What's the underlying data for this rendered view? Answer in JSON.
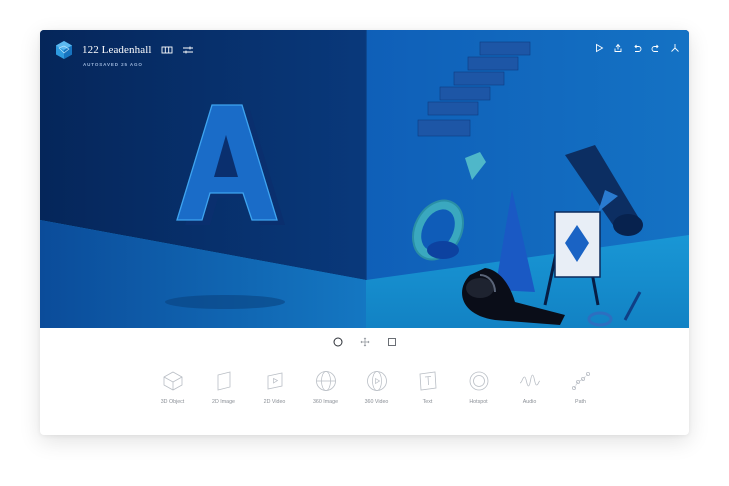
{
  "project": {
    "title": "122 Leadenhall",
    "autosave_status": "AUTOSAVED 25 AGO"
  },
  "header_icons_left": [
    "map-icon",
    "settings-sliders-icon"
  ],
  "header_icons_right": [
    "play-icon",
    "share-icon",
    "undo-icon",
    "redo-icon",
    "compass-icon"
  ],
  "view_modes": [
    "sphere-view-icon",
    "move-icon",
    "square-view-icon"
  ],
  "toolbar": {
    "items": [
      {
        "label": "3D Object",
        "icon": "cube-icon"
      },
      {
        "label": "2D Image",
        "icon": "image-plane-icon"
      },
      {
        "label": "2D Video",
        "icon": "video-plane-icon"
      },
      {
        "label": "360 Image",
        "icon": "globe-icon"
      },
      {
        "label": "360 Video",
        "icon": "globe-video-icon"
      },
      {
        "label": "Text",
        "icon": "text-icon"
      },
      {
        "label": "Hotspot",
        "icon": "hotspot-icon"
      },
      {
        "label": "Audio",
        "icon": "audio-wave-icon"
      },
      {
        "label": "Path",
        "icon": "path-icon"
      }
    ]
  },
  "colors": {
    "scene_dark": "#0b3f8a",
    "scene_light": "#1790d0",
    "accent": "#1a9ad8"
  }
}
